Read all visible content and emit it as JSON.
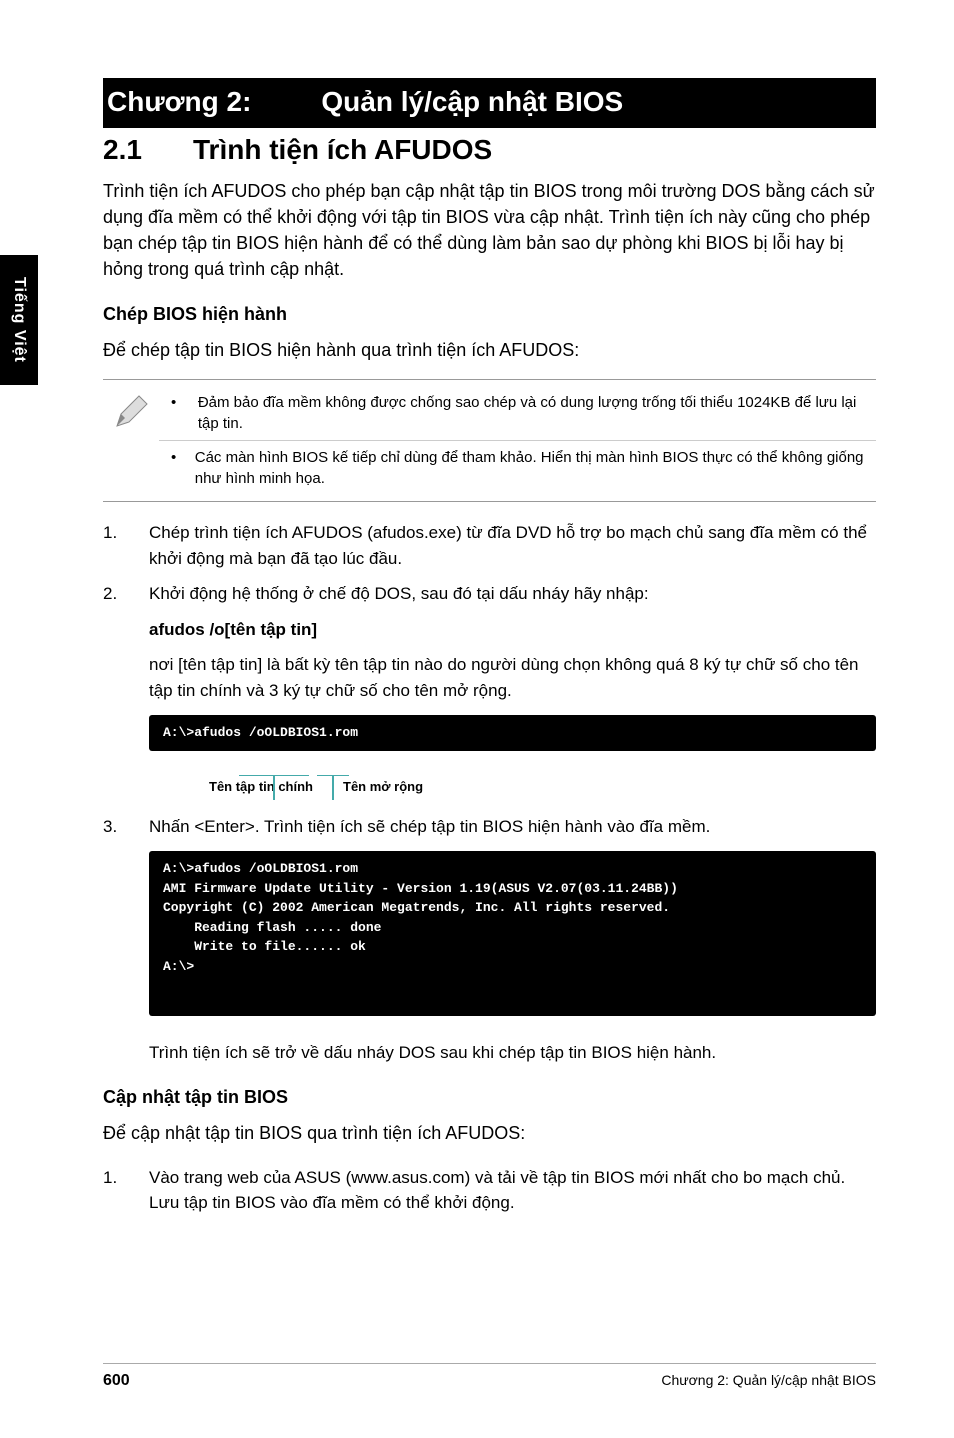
{
  "sideTab": "Tiếng Việt",
  "chapter": {
    "label": "Chương 2:",
    "title": "Quản lý/cập nhật BIOS"
  },
  "section": {
    "num": "2.1",
    "title": "Trình tiện ích AFUDOS"
  },
  "intro": "Trình tiện ích AFUDOS cho phép bạn cập nhật tập tin BIOS trong môi trường DOS bằng cách sử dụng đĩa mềm có thể khởi động với tập tin BIOS vừa cập nhật. Trình tiện ích này cũng cho phép bạn chép tập tin BIOS hiện hành để có thể dùng làm bản sao dự phòng khi BIOS bị lỗi hay bị hỏng trong quá trình cập nhật.",
  "sub1": "Chép BIOS hiện hành",
  "sub1_lead": "Để chép tập tin BIOS hiện hành qua trình tiện ích AFUDOS:",
  "notes": [
    "Đảm bảo đĩa mềm không được chống sao chép và có dung lượng trống tối thiểu 1024KB để lưu lại tập tin.",
    "Các màn hình BIOS kế tiếp chỉ dùng để tham khảo. Hiển thị màn hình BIOS thực có thể không giống như hình minh họa."
  ],
  "steps1": [
    {
      "n": "1.",
      "t": "Chép trình tiện ích AFUDOS (afudos.exe) từ đĩa DVD hỗ trợ bo mạch chủ sang đĩa mềm có thể khởi động mà bạn đã tạo lúc đầu."
    },
    {
      "n": "2.",
      "t": "Khởi động hệ thống ở chế độ DOS, sau đó tại dấu nháy hãy nhập:"
    }
  ],
  "cmd1": "afudos /o[tên tập tin]",
  "cmd1_note": "nơi [tên tập tin] là bất kỳ tên tập tin nào do người dùng chọn không quá 8 ký tự chữ số cho tên tập tin chính và 3 ký tự chữ số cho tên mở rộng.",
  "term1": "A:\\>afudos /oOLDBIOS1.rom",
  "annot": {
    "main": "Tên tập tin chính",
    "ext": "Tên mở rộng"
  },
  "steps2": [
    {
      "n": "3.",
      "t": "Nhấn <Enter>. Trình tiện ích sẽ chép tập tin BIOS hiện hành vào đĩa mềm."
    }
  ],
  "term2": "A:\\>afudos /oOLDBIOS1.rom\nAMI Firmware Update Utility - Version 1.19(ASUS V2.07(03.11.24BB))\nCopyright (C) 2002 American Megatrends, Inc. All rights reserved.\n    Reading flash ..... done\n    Write to file...... ok\nA:\\>\n ",
  "after_term2": "Trình tiện ích sẽ trở về dấu nháy DOS sau khi chép tập tin BIOS hiện hành.",
  "sub2": "Cập nhật tập tin BIOS",
  "sub2_lead": "Để cập nhật tập tin BIOS qua trình tiện ích AFUDOS:",
  "steps3": [
    {
      "n": "1.",
      "t": "Vào trang web của ASUS (www.asus.com) và tải về tập tin BIOS mới nhất cho bo mạch chủ. Lưu tập tin BIOS vào đĩa mềm có thể khởi động."
    }
  ],
  "footer": {
    "page": "600",
    "right": "Chương 2: Quản lý/cập nhật BIOS"
  }
}
